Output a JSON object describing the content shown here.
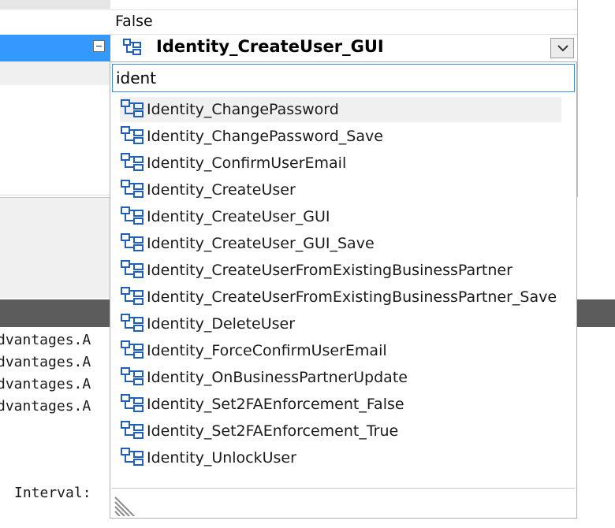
{
  "property_grid": {
    "prev_value": "False",
    "selected_value": "Identity_CreateUser_GUI"
  },
  "filter": {
    "value": "ident"
  },
  "options": [
    "Identity_ChangePassword",
    "Identity_ChangePassword_Save",
    "Identity_ConfirmUserEmail",
    "Identity_CreateUser",
    "Identity_CreateUser_GUI",
    "Identity_CreateUser_GUI_Save",
    "Identity_CreateUserFromExistingBusinessPartner",
    "Identity_CreateUserFromExistingBusinessPartner_Save",
    "Identity_DeleteUser",
    "Identity_ForceConfirmUserEmail",
    "Identity_OnBusinessPartnerUpdate",
    "Identity_Set2FAEnforcement_False",
    "Identity_Set2FAEnforcement_True",
    "Identity_UnlockUser"
  ],
  "highlighted_index": 0,
  "code_lines": [
    "dvantages.A",
    "dvantages.A",
    "dvantages.A",
    "dvantages.A"
  ],
  "interval_label": "Interval:",
  "icons": {
    "item_icon": "workflow-node-icon",
    "dropdown": "chevron-down-icon",
    "collapse": "collapse-minus-icon",
    "resize": "resize-grip-icon"
  },
  "colors": {
    "selection_blue": "#3399ff",
    "icon_blue": "#1f5fbf",
    "focus_border": "#3c8dde",
    "dark_band": "#5c5c5c"
  }
}
